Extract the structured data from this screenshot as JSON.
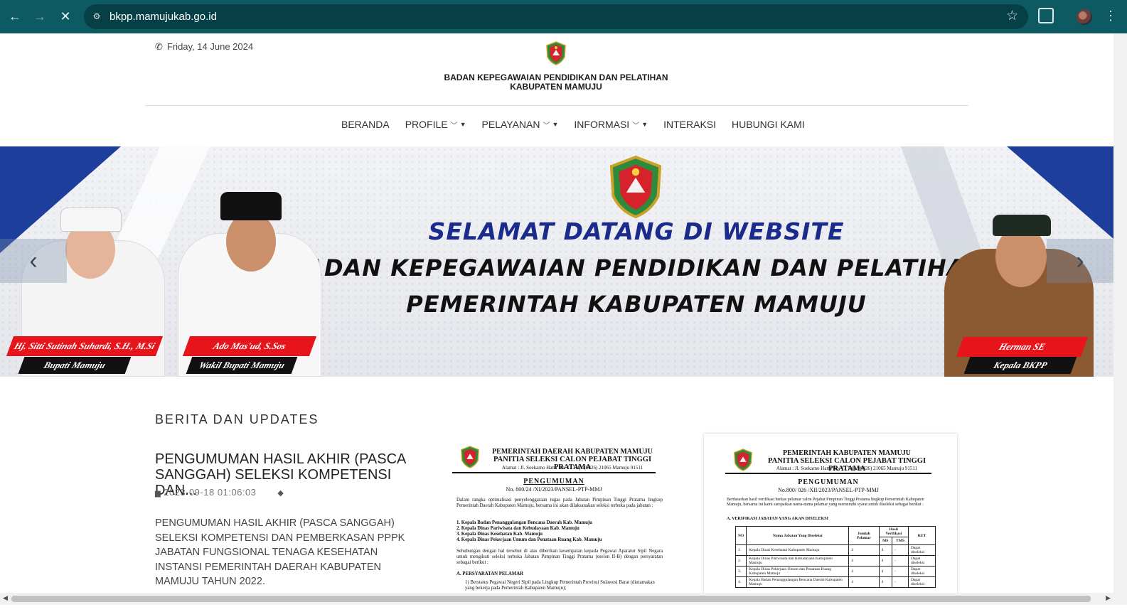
{
  "browser": {
    "url": "bkpp.mamujukab.go.id",
    "back_icon": "arrow-left-icon",
    "forward_icon": "arrow-right-icon",
    "stop_icon": "close-icon"
  },
  "header": {
    "date": "Friday, 14 June 2024",
    "org_line1": "BADAN KEPEGAWAIAN PENDIDIKAN DAN PELATIHAN",
    "org_line2": "KABUPATEN MAMUJU"
  },
  "menu": {
    "items": [
      "BERANDA",
      "PROFILE",
      "PELAYANAN",
      "INFORMASI",
      "INTERAKSI",
      "HUBUNGI KAMI"
    ]
  },
  "banner": {
    "title1": "SELAMAT DATANG DI WEBSITE",
    "title2": "BADAN KEPEGAWAIAN PENDIDIKAN DAN PELATIHAN",
    "title3": "PEMERINTAH KABUPATEN MAMUJU",
    "people": [
      {
        "name": "Hj. Sitti Sutinah Suhardi, S.H., M.Si",
        "role": "Bupati Mamuju"
      },
      {
        "name": "Ado Mas'ud, S.Sos",
        "role": "Wakil Bupati Mamuju"
      },
      {
        "name": "Herman SE",
        "role": "Kepala BKPP"
      }
    ],
    "prev_arrow": "‹",
    "next_arrow": "›"
  },
  "news": {
    "section_title": "BERITA DAN UPDATES",
    "post_title": "PENGUMUMAN HASIL AKHIR (PASCA SANGGAH) SELEKSI KOMPETENSI DAN...",
    "post_date": "2023-09-18 01:06:03",
    "excerpt": "PENGUMUMAN HASIL AKHIR (PASCA SANGGAH) SELEKSI KOMPETENSI DAN PEMBERKASAN  PPPK JABATAN FUNGSIONAL TENAGA KESEHATAN INSTANSI PEMERINTAH DAERAH KABUPATEN MAMUJU TAHUN 2022."
  },
  "doc1": {
    "h1": "PEMERINTAH DAERAH KABUPATEN MAMUJU",
    "h2": "PANITIA SELEKSI CALON PEJABAT TINGGI PRATAMA",
    "addr": "Alamat : Jl. Soekarno Hatta No. 17 Telp. (0426) 21065 Mamuju 91511",
    "title": "PENGUMUMAN",
    "no": "No. 800/24 /XI/2023/PANSEL-PTP-MMJ",
    "p1": "Dalam rangka optimalisasi penyelenggaraan tugas pada Jabatan Pimpinan Tinggi Pratama lingkup Pemerintah Daerah Kabupaten Mamuju, bersama ini akan dilaksanakan seleksi terbuka pada jabatan :",
    "list": [
      "1.  Kepala Badan Penanggulangan Bencana Daerah Kab. Mamuju",
      "2.  Kepala Dinas Pariwisata dan Kebudayaan Kab. Mamuju",
      "3.  Kepala Dinas Kesehatan Kab. Mamuju",
      "4.  Kepala Dinas Pekerjaan Umum dan Penataan Ruang Kab. Mamuju"
    ],
    "p2": "Sehubungan dengan hal tersebut di atas diberikan kesempatan kepada Pegawai Aparatur Sipil Negara untuk mengikuti seleksi terbuka Jabatan Pimpinan Tinggi Pratama (eselon II-B) dengan persyaratan sebagai berikut :",
    "section": "A.  PERSYARATAN PELAMAR",
    "p3": "1)  Berstatus Pegawai Negeri Sipil pada Lingkup Pemerintah Provinsi Sulawesi Barat (diutamakan yang bekerja pada Pemerintah Kabupaten Mamuju);"
  },
  "doc2": {
    "h1": "PEMERINTAH KABUPATEN MAMUJU",
    "h2": "PANITIA SELEKSI CALON PEJABAT TINGGI PRATAMA",
    "addr": "Alamat : Jl. Soekarno Hatta No. 17 Telp. (0426) 21065 Mamuju 91511",
    "title": "PENGUMUMAN",
    "no": "No.800/ 026 /XII/2023/PANSEL-PTP-MMJ",
    "p1": "Berdasarkan hasil verifikasi berkas pelamar calon Pejabat Pimpinan Tinggi Pratama lingkup Pemerintah Kabupaten Mamuju, bersama ini kami sampaikan nama-nama pelamar yang memenuhi syarat untuk diseleksi sebagai berikut :",
    "section": "A.  VERIFIKASI JABATAN YANG AKAN DISELEKSI",
    "table_headers": [
      "NO",
      "Nama Jabatan Yang Diseleksi",
      "Jumlah Pelamar",
      "Hasil Verifikasi",
      "KET"
    ],
    "sub_headers": [
      "MS",
      "TMS"
    ],
    "rows": [
      [
        "1.",
        "Kepala Dinas Kesehatan Kabupaten Mamuju",
        "4",
        "4",
        "-",
        "Dapat diseleksi"
      ],
      [
        "2.",
        "Kepala Dinas Pariwisata dan Kebudayaan Kabupaten Mamuju",
        "4",
        "4",
        "-",
        "Dapat diseleksi"
      ],
      [
        "3.",
        "Kepala Dinas Pekerjaan Umum dan Penataan Ruang Kabupaten Mamuju",
        "4",
        "4",
        "-",
        "Dapat diseleksi"
      ],
      [
        "4.",
        "Kepala Badan Penanggulangan Bencana Daerah Kabupaten Mamuju",
        "4",
        "4",
        "-",
        "Dapat diseleksi"
      ]
    ]
  },
  "colors": {
    "chrome": "#0d5a63",
    "banner_blue": "#1d3e9a",
    "banner_title_blue": "#1a2b8c",
    "tag_red": "#e8141c"
  }
}
